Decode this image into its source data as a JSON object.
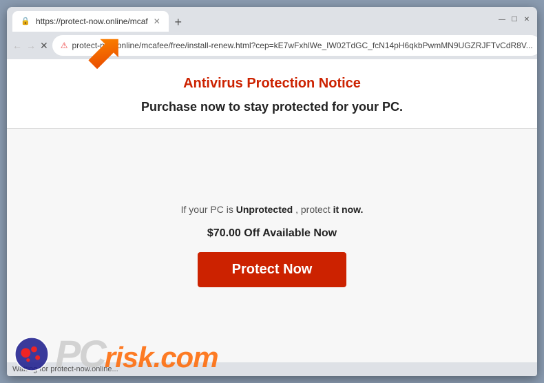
{
  "browser": {
    "tab": {
      "title": "https://protect-now.online/mcaf",
      "favicon": "🔒"
    },
    "new_tab_label": "+",
    "window_controls": {
      "minimize": "—",
      "maximize": "☐",
      "close": "✕"
    },
    "nav": {
      "back": "←",
      "forward": "→",
      "close": "✕",
      "back_disabled": true,
      "forward_disabled": true
    },
    "address": {
      "lock_icon": "⚠",
      "url": "protect-now.online/mcafee/free/install-renew.html?cep=kE7wFxhlWe_IW02TdGC_fcN14pH6qkbPwmMN9UGZRJFTvCdR8V..."
    },
    "bookmark_icon": "★",
    "account_icon": "◉",
    "menu_icon": "⋮"
  },
  "page": {
    "antivirus_title": "Antivirus Protection Notice",
    "purchase_text": "Purchase now to stay protected for your PC.",
    "unprotected_line": "If your PC is",
    "unprotected_word": "Unprotected",
    "protect_phrase": ", protect",
    "it_now": " it now.",
    "discount": "$70.00 Off Available Now",
    "protect_btn": "Protect Now"
  },
  "status": {
    "text": "Waiting for protect-now.online..."
  },
  "watermark": {
    "pc": "PC",
    "risk": "risk.com"
  }
}
